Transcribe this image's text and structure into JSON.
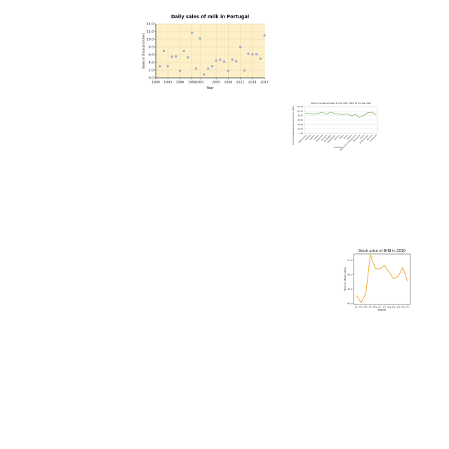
{
  "chart_data": [
    {
      "type": "scatter",
      "title": "Daily sales of milk in Portugal",
      "xlabel": "Year",
      "ylabel": "Sales in thousand liters",
      "xlim": [
        1990,
        2017
      ],
      "ylim": [
        0,
        14
      ],
      "xticks": [
        "1990",
        "1993",
        "1996",
        "1999",
        "2001",
        "2005",
        "2008",
        "2011",
        "2014",
        "2017"
      ],
      "yticks": [
        "0.0",
        "2.0",
        "4.0",
        "6.0",
        "8.0",
        "10.0",
        "12.0",
        "14.0"
      ],
      "grid": true,
      "colors": {
        "background": "#fdf0c8",
        "point": "#9fa8c7",
        "grid": "#e9d9a6"
      },
      "x": [
        1991,
        1992,
        1993,
        1994,
        1995,
        1996,
        1997,
        1998,
        1999,
        2000,
        2001,
        2002,
        2003,
        2004,
        2005,
        2006,
        2007,
        2008,
        2009,
        2010,
        2011,
        2012,
        2013,
        2014,
        2015,
        2016,
        2017
      ],
      "y": [
        3.0,
        7.0,
        3.0,
        5.5,
        5.6,
        1.8,
        7.0,
        5.3,
        11.7,
        2.4,
        10.2,
        0.9,
        2.4,
        3.0,
        4.5,
        4.7,
        4.2,
        1.8,
        4.7,
        4.3,
        8.0,
        1.9,
        6.3,
        6.1,
        6.1,
        5.0,
        11.0
      ]
    },
    {
      "type": "line",
      "title": "Share of cereals allocated to food (FAO, 2009) for the Year 2003",
      "xlabel": "Country",
      "ylabel": "Share of cereals allocated to food (FAO, 2009)",
      "ylim": [
        0,
        120
      ],
      "yticks": [
        "0.00",
        "20.00",
        "40.00",
        "60.00",
        "80.00",
        "100.00",
        "120.00"
      ],
      "categories": [
        "Afghanistan",
        "Albania",
        "Algeria",
        "Angola",
        "Argentina",
        "Armenia",
        "Azerbaijan",
        "Bangladesh",
        "Belarus",
        "Belize",
        "Benin",
        "Bolivia",
        "Bosnia and Herzegovina",
        "Botswana",
        "Brazil",
        "Burkina Faso",
        "Burundi",
        "Cambodia"
      ],
      "values": [
        90,
        88,
        86,
        90,
        95,
        85,
        96,
        88,
        87,
        84,
        88,
        79,
        85,
        72,
        80,
        93,
        95,
        83
      ],
      "grid": true,
      "colors": {
        "line": "#7fb069"
      }
    },
    {
      "type": "line",
      "title": "Stock price of BHB in 2010",
      "xlabel": "Month",
      "ylabel": "Price of Stock (USD)",
      "ylim": [
        39.7,
        53.8
      ],
      "yticks": [
        "40.0",
        "44.0",
        "48.0",
        "52.0"
      ],
      "categories": [
        "Jan",
        "Feb",
        "Mar",
        "Apr",
        "May",
        "Jun",
        "Jul",
        "Aug",
        "Sep",
        "Oct",
        "Nov",
        "Dec"
      ],
      "values": [
        42.2,
        40.2,
        42.6,
        53.6,
        49.8,
        49.6,
        50.6,
        48.8,
        46.8,
        47.6,
        50.0,
        46.2
      ],
      "grid": false,
      "colors": {
        "line": "#f3a833"
      }
    }
  ]
}
